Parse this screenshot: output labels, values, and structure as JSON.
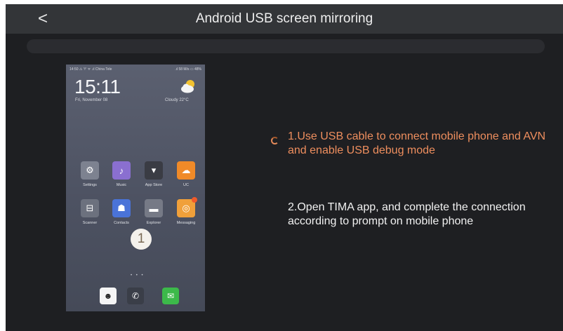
{
  "header": {
    "title": "Android USB screen mirroring",
    "back_label": "<"
  },
  "phone": {
    "status_left": "14:50 ⚠ ♈ ᯤ .ıl China Tele",
    "status_right": ".ıl 58 M/s ▭ 48%",
    "clock": "15:11",
    "date": "Fri, November 08",
    "weather": "Cloudy 22°C",
    "apps": [
      {
        "label": "Settings",
        "icon": "gear-icon",
        "glyph": "⚙",
        "color": "#7d8290"
      },
      {
        "label": "Music",
        "icon": "music-note-icon",
        "glyph": "♪",
        "color": "#8a6fd0"
      },
      {
        "label": "App Store",
        "icon": "app-store-icon",
        "glyph": "▾",
        "color": "#3a3c44"
      },
      {
        "label": "UC",
        "icon": "uc-browser-icon",
        "glyph": "☁",
        "color": "#f08a28"
      },
      {
        "label": "Scanner",
        "icon": "scanner-icon",
        "glyph": "⊟",
        "color": "#6c717e"
      },
      {
        "label": "Contacts",
        "icon": "contacts-icon",
        "glyph": "☗",
        "color": "#4a73d8"
      },
      {
        "label": "Explorer",
        "icon": "folder-icon",
        "glyph": "▬",
        "color": "#767a86"
      },
      {
        "label": "Messaging",
        "icon": "message-icon",
        "glyph": "◎",
        "color": "#f0a03a"
      }
    ],
    "step_number": "1",
    "page_dots": "• • •",
    "dock": [
      {
        "icon": "qq-penguin-icon",
        "glyph": "☻",
        "color": "#f5f5f5"
      },
      {
        "icon": "phone-icon",
        "glyph": "✆",
        "color": "#3a3e48"
      },
      {
        "icon": "wechat-icon",
        "glyph": "✉",
        "color": "#3cb94a"
      }
    ]
  },
  "instructions": {
    "step1": "1.Use USB cable to connect mobile phone and AVN and enable USB debug mode",
    "step2": "2.Open TIMA app, and complete the connection according to prompt on mobile phone"
  },
  "colors": {
    "active_step": "#ee8e5e",
    "inactive_step": "#f1f1f1",
    "background": "#1e1f22",
    "header": "#333538"
  }
}
